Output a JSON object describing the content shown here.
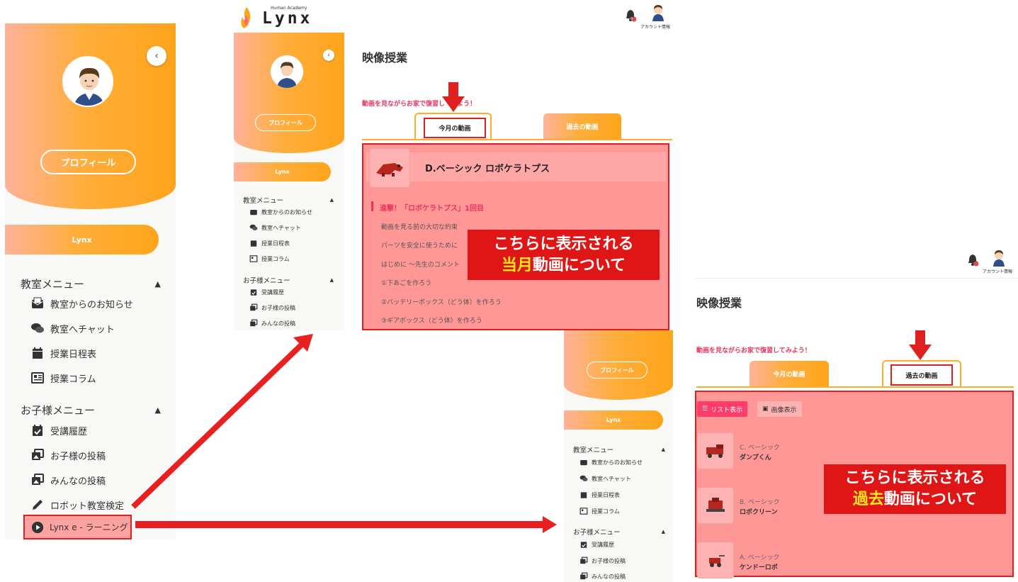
{
  "brand": {
    "small": "Human Academy",
    "name": "Lynx",
    "notification_count": "0",
    "account_label": "アカウント情報"
  },
  "sidebar": {
    "profile_button": "プロフィール",
    "lynx_pill": "Lynx",
    "classroom_menu": {
      "title": "教室メニュー",
      "collapse_glyph": "▲",
      "items": [
        {
          "label": "教室からのお知らせ",
          "icon": "envelope-icon"
        },
        {
          "label": "教室へチャット",
          "icon": "chat-icon"
        },
        {
          "label": "授業日程表",
          "icon": "calendar-icon"
        },
        {
          "label": "授業コラム",
          "icon": "newspaper-icon"
        }
      ]
    },
    "child_menu": {
      "title": "お子様メニュー",
      "collapse_glyph": "▲",
      "items": [
        {
          "label": "受講履歴",
          "icon": "calendar-check-icon"
        },
        {
          "label": "お子様の投稿",
          "icon": "photos-icon"
        },
        {
          "label": "みんなの投稿",
          "icon": "photos-icon"
        },
        {
          "label": "ロボット教室検定",
          "icon": "pencil-icon"
        },
        {
          "label": "Lynx e - ラーニング",
          "icon": "play-circle-icon"
        }
      ]
    }
  },
  "video_page": {
    "title": "映像授業",
    "subtitle": "動画を見ながらお家で復習してみよう！",
    "subtitle_partial_left": "動画を見ながらお家で復習し",
    "subtitle_partial_right": "よう！",
    "tab_current": "今月の動画",
    "tab_past": "過去の動画",
    "course_title": "D.ベーシック ロボケラトプス",
    "lesson_heading": "進撃！「ロボケラトプス」1回目",
    "lessons": [
      "動画を見る前の大切な約束",
      "パーツを安全に使うために",
      "はじめに 〜先生のコメント",
      "①下あごを作ろう",
      "②バッテリーボックス（どう体）を作ろう",
      "③ギアボックス（どう体）を作ろう"
    ],
    "view_list": "リスト表示",
    "view_image": "画像表示",
    "past_videos": [
      {
        "course": "C. ベーシック",
        "name": "ダンプくん"
      },
      {
        "course": "B. ベーシック",
        "name": "ロボクリーン"
      },
      {
        "course": "A. ベーシック",
        "name": "ケンドーロボ"
      }
    ]
  },
  "callouts": {
    "current": {
      "line1": "こちらに表示される",
      "highlight": "当月",
      "rest": "動画について"
    },
    "past": {
      "line1": "こちらに表示される",
      "highlight": "過去",
      "rest": "動画について"
    }
  },
  "colors": {
    "orange": "#ffa41a",
    "peach": "#ffb29a",
    "pink_text": "#e8345e",
    "annotation_red": "#e02020",
    "highlight_yellow": "#ffe81a"
  }
}
